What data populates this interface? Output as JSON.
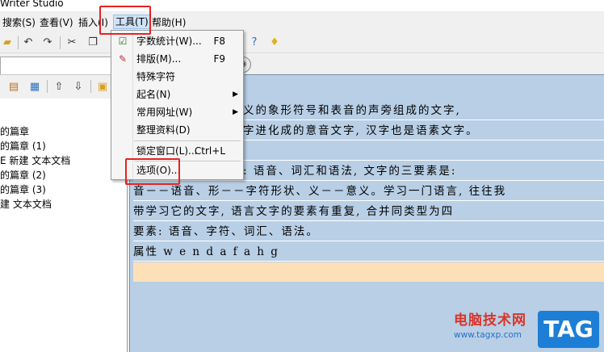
{
  "window": {
    "title": "Writer Studio"
  },
  "menubar": {
    "items": [
      {
        "label": "搜索(S)"
      },
      {
        "label": "查看(V)"
      },
      {
        "label": "插入(I)"
      },
      {
        "label": "工具(T)"
      },
      {
        "label": "帮助(H)"
      }
    ]
  },
  "tools_menu": {
    "items": [
      {
        "label": "字数统计(W)...",
        "shortcut": "F8",
        "icon": "checkbox-check-icon"
      },
      {
        "label": "排版(M)...",
        "shortcut": "F9",
        "icon": "format-pen-icon"
      },
      {
        "label": "特殊字符"
      },
      {
        "label": "起名(N)",
        "submenu": true
      },
      {
        "label": "常用网址(W)",
        "submenu": true
      },
      {
        "label": "整理资料(D)"
      },
      {
        "label": "锁定窗口(L)...",
        "shortcut": "Ctrl+L"
      },
      {
        "label": "选项(O)..."
      }
    ]
  },
  "tree": {
    "items": [
      {
        "label": "的篇章"
      },
      {
        "label": "的篇章 (1)"
      },
      {
        "label": "E 新建 文本文档"
      },
      {
        "label": "的篇章 (2)"
      },
      {
        "label": "的篇章 (3)"
      },
      {
        "label": "建 文本文档"
      }
    ]
  },
  "editor": {
    "lines": [
      "义的象形符号和表音的声旁组成的文字,",
      "字进化成的意音文字, 汉字也是语素文字。",
      "",
      ": 语音、词汇和语法, 文字的三要素是:",
      "音－－语音、形－－字符形状、义－－意义。学习一门语言, 往往我",
      "带学习它的文字, 语言文字的要素有重复, 合并同类型为四",
      "要素: 语音、字符、词汇、语法。",
      "属性  w e n d a f a h g"
    ]
  },
  "watermark": {
    "title": "电脑技术网",
    "url": "www.tagxp.com",
    "badge": "TAG"
  },
  "colors": {
    "editor_bg": "#b8cfe6",
    "current_line": "#fde0b8",
    "highlight_box": "#e62222",
    "watermark_red": "#d8352a",
    "watermark_blue": "#1d7ed6"
  }
}
